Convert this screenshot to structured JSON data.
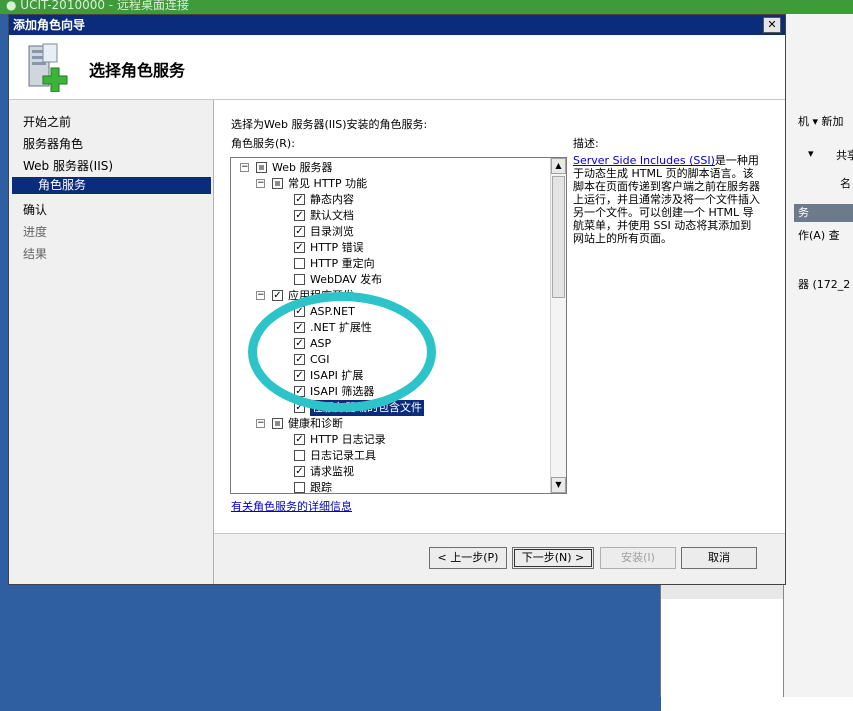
{
  "background": {
    "top_title": "● UCIT-2010000 - 远程桌面连接",
    "side_texts": [
      "机 ▾ 新加",
      "▾",
      "共享",
      "名",
      "务",
      "作(A)  查",
      "器 (172_2"
    ]
  },
  "dialog": {
    "title": "添加角色向导",
    "close_label": "✕",
    "header_title": "选择角色服务",
    "nav": [
      {
        "label": "开始之前",
        "state": "normal"
      },
      {
        "label": "服务器角色",
        "state": "normal"
      },
      {
        "label": "Web 服务器(IIS)",
        "state": "normal"
      },
      {
        "label": "角色服务",
        "state": "selected"
      },
      {
        "label": "确认",
        "state": "normal"
      },
      {
        "label": "进度",
        "state": "dim"
      },
      {
        "label": "结果",
        "state": "dim"
      }
    ],
    "instruction": "选择为Web 服务器(IIS)安装的角色服务:",
    "tree_label": "角色服务(R):",
    "tree": [
      {
        "label": "Web 服务器",
        "state": "partial",
        "expander": "⊟",
        "level": 0
      },
      {
        "label": "常见 HTTP 功能",
        "state": "partial",
        "expander": "⊟",
        "level": 1
      },
      {
        "label": "静态内容",
        "state": "checked",
        "level": 2
      },
      {
        "label": "默认文档",
        "state": "checked",
        "level": 2
      },
      {
        "label": "目录浏览",
        "state": "checked",
        "level": 2
      },
      {
        "label": "HTTP 错误",
        "state": "checked",
        "level": 2
      },
      {
        "label": "HTTP 重定向",
        "state": "unchecked",
        "level": 2
      },
      {
        "label": "WebDAV 发布",
        "state": "unchecked",
        "level": 2
      },
      {
        "label": "应用程序开发",
        "state": "checked",
        "expander": "⊟",
        "level": 1
      },
      {
        "label": "ASP.NET",
        "state": "checked",
        "level": 2
      },
      {
        "label": ".NET 扩展性",
        "state": "checked",
        "level": 2
      },
      {
        "label": "ASP",
        "state": "checked",
        "level": 2
      },
      {
        "label": "CGI",
        "state": "checked",
        "level": 2
      },
      {
        "label": "ISAPI 扩展",
        "state": "checked",
        "level": 2
      },
      {
        "label": "ISAPI 筛选器",
        "state": "checked",
        "level": 2
      },
      {
        "label": "在服务器端的包含文件",
        "state": "checked",
        "level": 2,
        "highlight": true
      },
      {
        "label": "健康和诊断",
        "state": "partial",
        "expander": "⊟",
        "level": 1
      },
      {
        "label": "HTTP 日志记录",
        "state": "checked",
        "level": 2
      },
      {
        "label": "日志记录工具",
        "state": "unchecked",
        "level": 2
      },
      {
        "label": "请求监视",
        "state": "checked",
        "level": 2
      },
      {
        "label": "跟踪",
        "state": "unchecked",
        "level": 2
      }
    ],
    "desc_label": "描述:",
    "desc_link": "Server Side Includes (SSI)",
    "desc_text": "是一种用于动态生成 HTML 页的脚本语言。该脚本在页面传递到客户端之前在服务器上运行，并且通常涉及将一个文件插入另一个文件。可以创建一个 HTML 导航菜单，并使用 SSI 动态将其添加到网站上的所有页面。",
    "more_link": "有关角色服务的详细信息",
    "buttons": {
      "back": "< 上一步(P)",
      "next": "下一步(N) >",
      "install": "安装(I)",
      "cancel": "取消"
    }
  },
  "colors": {
    "titlebar": "#0b2c7a",
    "annotation_circle": "#2cc3c9",
    "desktop": "#2f5fa0"
  }
}
